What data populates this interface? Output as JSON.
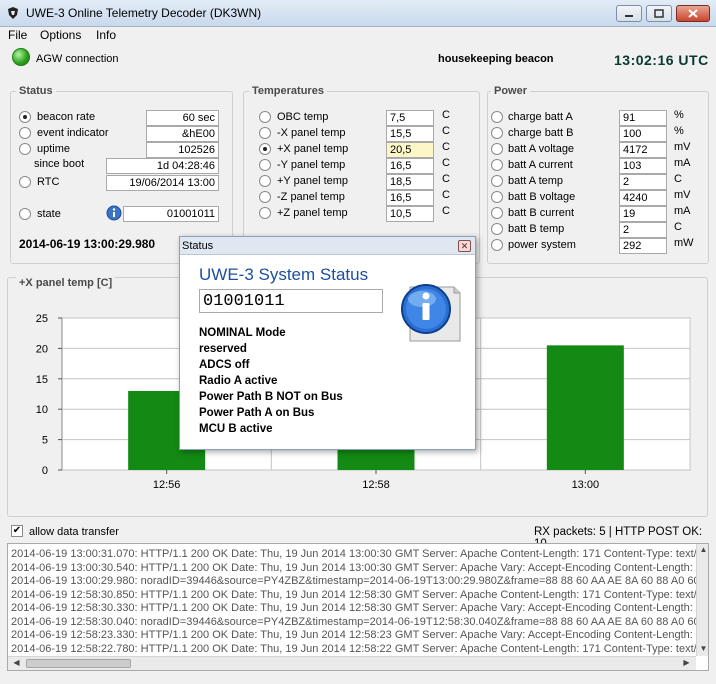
{
  "window": {
    "title": "UWE-3 Online Telemetry Decoder (DK3WN)"
  },
  "menu": [
    "File",
    "Options",
    "Info"
  ],
  "header": {
    "agw_label": "AGW connection",
    "beacon_type": "housekeeping beacon",
    "clock": "13:02:16 UTC",
    "agw_color": "#2ea51f"
  },
  "status_group": {
    "title": "Status",
    "rows": [
      {
        "label": "beacon rate",
        "value": "60 sec",
        "selected": true
      },
      {
        "label": "event indicator",
        "value": "&hE00",
        "selected": false
      },
      {
        "label": "uptime",
        "value": "102526",
        "selected": false
      },
      {
        "label": "since boot",
        "value": "1d 04:28:46"
      },
      {
        "label": "RTC",
        "value": "19/06/2014 13:00",
        "selected": false
      },
      {
        "label": "state",
        "value": "01001011",
        "selected": false
      }
    ],
    "timestamp": "2014-06-19 13:00:29.980",
    "info_icon": "info-icon"
  },
  "temperatures": {
    "title": "Temperatures",
    "rows": [
      {
        "label": "OBC temp",
        "value": "7,5",
        "unit": "C",
        "selected": false
      },
      {
        "label": "-X panel temp",
        "value": "15,5",
        "unit": "C",
        "selected": false
      },
      {
        "label": "+X panel temp",
        "value": "20,5",
        "unit": "C",
        "selected": true
      },
      {
        "label": "-Y panel temp",
        "value": "16,5",
        "unit": "C",
        "selected": false
      },
      {
        "label": "+Y panel temp",
        "value": "18,5",
        "unit": "C",
        "selected": false
      },
      {
        "label": "-Z panel temp",
        "value": "16,5",
        "unit": "C",
        "selected": false
      },
      {
        "label": "+Z panel temp",
        "value": "10,5",
        "unit": "C",
        "selected": false
      }
    ]
  },
  "power": {
    "title": "Power",
    "rows": [
      {
        "label": "charge batt A",
        "value": "91",
        "unit": "%"
      },
      {
        "label": "charge batt B",
        "value": "100",
        "unit": "%"
      },
      {
        "label": "batt A voltage",
        "value": "4172",
        "unit": "mV"
      },
      {
        "label": "batt A current",
        "value": "103",
        "unit": "mA"
      },
      {
        "label": "batt A temp",
        "value": "2",
        "unit": "C"
      },
      {
        "label": "batt B voltage",
        "value": "4240",
        "unit": "mV"
      },
      {
        "label": "batt B current",
        "value": "19",
        "unit": "mA"
      },
      {
        "label": "batt B temp",
        "value": "2",
        "unit": "C"
      },
      {
        "label": "power system",
        "value": "292",
        "unit": "mW"
      }
    ]
  },
  "chart_data": {
    "type": "bar",
    "title": "+X panel temp [C]",
    "categories": [
      "12:56",
      "12:58",
      "13:00"
    ],
    "values": [
      13,
      16,
      20.5
    ],
    "ylim": [
      0,
      25
    ],
    "yticks": [
      "0",
      "5",
      "10",
      "15",
      "20",
      "25"
    ],
    "bar_color": "#138a13",
    "grid": true
  },
  "dialog": {
    "title": "Status",
    "heading": "UWE-3 System Status",
    "value": "01001011",
    "lines": [
      "NOMINAL Mode",
      "reserved",
      "ADCS off",
      "Radio A active",
      "Power Path B NOT on Bus",
      "Power Path A on Bus",
      "MCU B active"
    ],
    "icon": "info-icon"
  },
  "footer": {
    "allow_label": "allow data transfer",
    "allow_checked": true,
    "rx_status": "RX packets: 5 | HTTP POST OK: 10"
  },
  "log": [
    "2014-06-19 13:00:31.070: HTTP/1.1 200 OK Date: Thu, 19 Jun 2014 13:00:30 GMT Server: Apache Content-Length: 171 Content-Type: text/",
    "2014-06-19 13:00:30.540: HTTP/1.1 200 OK Date: Thu, 19 Jun 2014 13:00:30 GMT Server: Apache Vary: Accept-Encoding Content-Length:",
    "2014-06-19 13:00:29.980: noradID=39446&source=PY4ZBZ&timestamp=2014-06-19T13:00:29.980Z&frame=88 88 60 AA AE 8A 60 88 A0 60 A",
    "2014-06-19 12:58:30.850: HTTP/1.1 200 OK Date: Thu, 19 Jun 2014 12:58:30 GMT Server: Apache Content-Length: 171 Content-Type: text/",
    "2014-06-19 12:58:30.330: HTTP/1.1 200 OK Date: Thu, 19 Jun 2014 12:58:30 GMT Server: Apache Vary: Accept-Encoding Content-Length:",
    "2014-06-19 12:58:30.040: noradID=39446&source=PY4ZBZ&timestamp=2014-06-19T12:58:30.040Z&frame=88 88 60 AA AE 8A 60 88 A0 60 A",
    "2014-06-19 12:58:23.330: HTTP/1.1 200 OK Date: Thu, 19 Jun 2014 12:58:23 GMT Server: Apache Vary: Accept-Encoding Content-Length:",
    "2014-06-19 12:58:22.780: HTTP/1.1 200 OK Date: Thu, 19 Jun 2014 12:58:22 GMT Server: Apache Content-Length: 171 Content-Type: text/"
  ]
}
